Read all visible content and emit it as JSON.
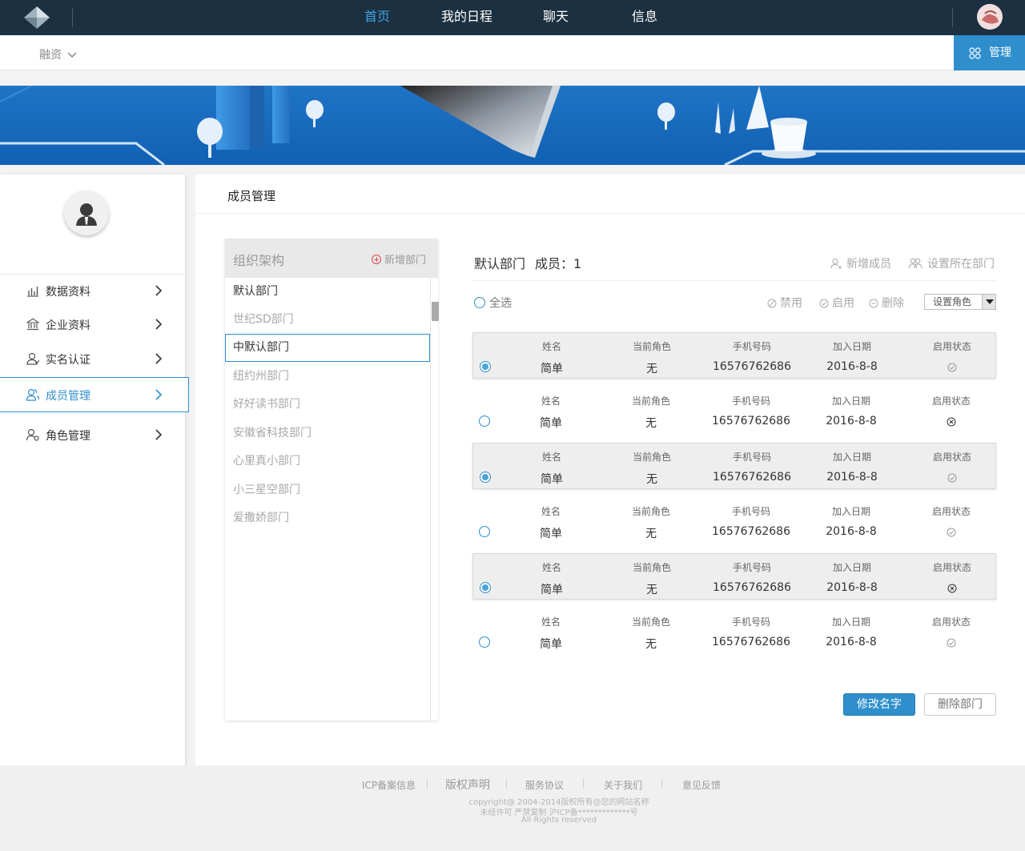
{
  "nav": {
    "items": [
      "首页",
      "我的日程",
      "聊天",
      "信息"
    ],
    "active": 0
  },
  "subbar": {
    "finance": "融资",
    "manage": "管理"
  },
  "sidebar": {
    "items": [
      {
        "label": "数据资料",
        "icon": "chart-icon"
      },
      {
        "label": "企业资料",
        "icon": "bank-icon"
      },
      {
        "label": "实名认证",
        "icon": "user-icon"
      },
      {
        "label": "成员管理",
        "icon": "members-icon"
      },
      {
        "label": "角色管理",
        "icon": "user-settings-icon"
      }
    ],
    "active": 3
  },
  "main": {
    "title": "成员管理"
  },
  "org": {
    "title": "组织架构",
    "add": "新增部门",
    "items": [
      "默认部门",
      "世纪SD部门",
      "中默认部门",
      "纽约州部门",
      "好好读书部门",
      "安徽省科技部门",
      "心里真小部门",
      "小三星空部门",
      "爱撒娇部门"
    ],
    "selected": 2
  },
  "dept": {
    "name": "默认部门",
    "members_label": "成员：1",
    "add_member": "新增成员",
    "set_dept": "设置所在部门"
  },
  "toolbar": {
    "select_all": "全选",
    "disable": "禁用",
    "enable": "启用",
    "delete": "删除",
    "set_role": "设置角色"
  },
  "columns": [
    "姓名",
    "当前角色",
    "手机号码",
    "加入日期",
    "启用状态"
  ],
  "rows": [
    {
      "name": "简单",
      "role": "无",
      "phone": "16576762686",
      "date": "2016-8-8",
      "enabled": true,
      "checked": true
    },
    {
      "name": "简单",
      "role": "无",
      "phone": "16576762686",
      "date": "2016-8-8",
      "enabled": false,
      "checked": false
    },
    {
      "name": "简单",
      "role": "无",
      "phone": "16576762686",
      "date": "2016-8-8",
      "enabled": true,
      "checked": true
    },
    {
      "name": "简单",
      "role": "无",
      "phone": "16576762686",
      "date": "2016-8-8",
      "enabled": true,
      "checked": false
    },
    {
      "name": "简单",
      "role": "无",
      "phone": "16576762686",
      "date": "2016-8-8",
      "enabled": false,
      "checked": true
    },
    {
      "name": "简单",
      "role": "无",
      "phone": "16576762686",
      "date": "2016-8-8",
      "enabled": true,
      "checked": false
    }
  ],
  "buttons": {
    "rename": "修改名字",
    "delete_dept": "删除部门"
  },
  "footer": {
    "links": [
      "ICP备案信息",
      "版权声明",
      "服务协议",
      "关于我们",
      "意见反馈"
    ],
    "copyright": "copyright@ 2004-2014版权所有@您的网站名称",
    "notice": "未经许可 严禁复制 沪ICP备*************号",
    "rights": "All Rights reserved"
  },
  "colors": {
    "topbar": "#1b3040",
    "accent": "#2f8fcd",
    "nav_active": "#3fa3e0"
  }
}
